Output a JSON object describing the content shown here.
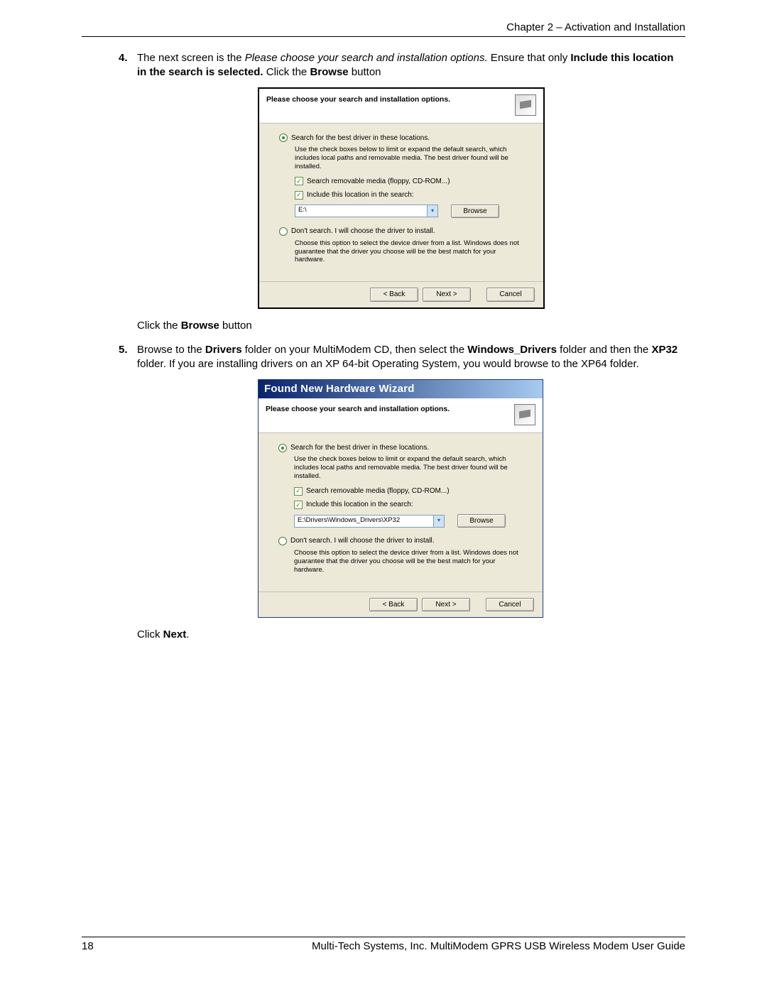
{
  "header": {
    "chapter": "Chapter 2 – Activation and Installation"
  },
  "step4": {
    "num": "4.",
    "t1": "The next screen is the ",
    "t2_italic": "Please choose your search and installation options.",
    "t3": "   Ensure that only ",
    "t4_bold": "Include this location in the search is selected.",
    "t5": "  Click the ",
    "t6_bold": "Browse",
    "t7": " button"
  },
  "wiz1": {
    "banner": "Please choose your search and installation options.",
    "r1": "Search for the best driver in these locations.",
    "desc1": "Use the check boxes below to limit or expand the default search, which includes local paths and removable media. The best driver found will be installed.",
    "chk1": "Search removable media (floppy, CD-ROM...)",
    "chk2": "Include this location in the search:",
    "path": "E:\\",
    "browse": "Browse",
    "r2": "Don't search. I will choose the driver to install.",
    "desc2": "Choose this option to select the device driver from a list. Windows does not guarantee that the driver you choose will be the best match for your hardware.",
    "back": "< Back",
    "next": "Next >",
    "cancel": "Cancel"
  },
  "mid_note": {
    "t1": "Click the ",
    "t2_bold": "Browse",
    "t3": " button"
  },
  "step5": {
    "num": "5.",
    "t1": "Browse to the ",
    "t2_bold": "Drivers",
    "t3": " folder on your MultiModem CD, then select the ",
    "t4_bold": "Windows_Drivers",
    "t5": " folder and then the ",
    "t6_bold": "XP32",
    "t7": " folder. If you are installing drivers on an XP 64-bit Operating System, you would browse to the XP64 folder."
  },
  "wiz2": {
    "title": "Found New Hardware Wizard",
    "banner": "Please choose your search and installation options.",
    "r1": "Search for the best driver in these locations.",
    "desc1": "Use the check boxes below to limit or expand the default search, which includes local paths and removable media. The best driver found will be installed.",
    "chk1": "Search removable media (floppy, CD-ROM...)",
    "chk2": "Include this location in the search:",
    "path": "E:\\Drivers\\Windows_Drivers\\XP32",
    "browse": "Browse",
    "r2": "Don't search. I will choose the driver to install.",
    "desc2": "Choose this option to select the device driver from a list.  Windows does not guarantee that the driver you choose will be the best match for your hardware.",
    "back": "< Back",
    "next": "Next >",
    "cancel": "Cancel"
  },
  "end_note": {
    "t1": "Click ",
    "t2_bold": "Next",
    "t3": "."
  },
  "footer": {
    "page": "18",
    "product": "Multi-Tech Systems, Inc. MultiModem GPRS USB Wireless Modem User Guide"
  }
}
